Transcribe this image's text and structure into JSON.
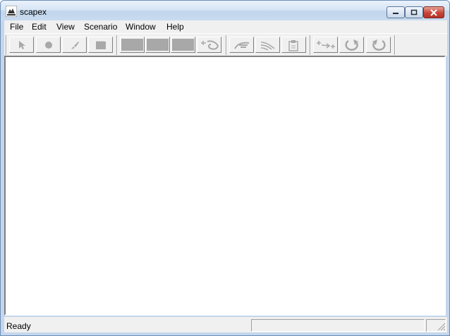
{
  "window": {
    "title": "scapex"
  },
  "menu": [
    "File",
    "Edit",
    "View",
    "Scenario",
    "Window",
    "Help"
  ],
  "toolbar": {
    "tools": [
      {
        "name": "pointer-tool",
        "icon": "arrow-cursor-icon"
      },
      {
        "name": "node-tool",
        "icon": "dot-icon"
      },
      {
        "name": "brush-tool",
        "icon": "brush-icon"
      },
      {
        "name": "film-tool",
        "icon": "film-frame-icon"
      },
      {
        "name": "panel-tool-1",
        "icon": "gray-block-icon"
      },
      {
        "name": "panel-tool-2",
        "icon": "gray-block-icon"
      },
      {
        "name": "panel-tool-3",
        "icon": "gray-block-icon"
      },
      {
        "name": "hand-wave-tool",
        "icon": "hand-wave-icon"
      },
      {
        "name": "hand-pointer-tool",
        "icon": "hand-pointer-icon"
      },
      {
        "name": "waves-tool",
        "icon": "waves-icon"
      },
      {
        "name": "clipboard-tool",
        "icon": "clipboard-icon"
      },
      {
        "name": "arrow-plus-tool",
        "icon": "arrow-plus-icon"
      },
      {
        "name": "redo-tool",
        "icon": "rotate-cw-icon"
      },
      {
        "name": "undo-tool",
        "icon": "rotate-ccw-icon"
      }
    ]
  },
  "status": {
    "text": "Ready"
  },
  "colors": {
    "titlebar": "#c9dbef",
    "close_button": "#c8453a",
    "disabled_icon": "#a8a8a8",
    "chrome": "#f0f0f0"
  }
}
